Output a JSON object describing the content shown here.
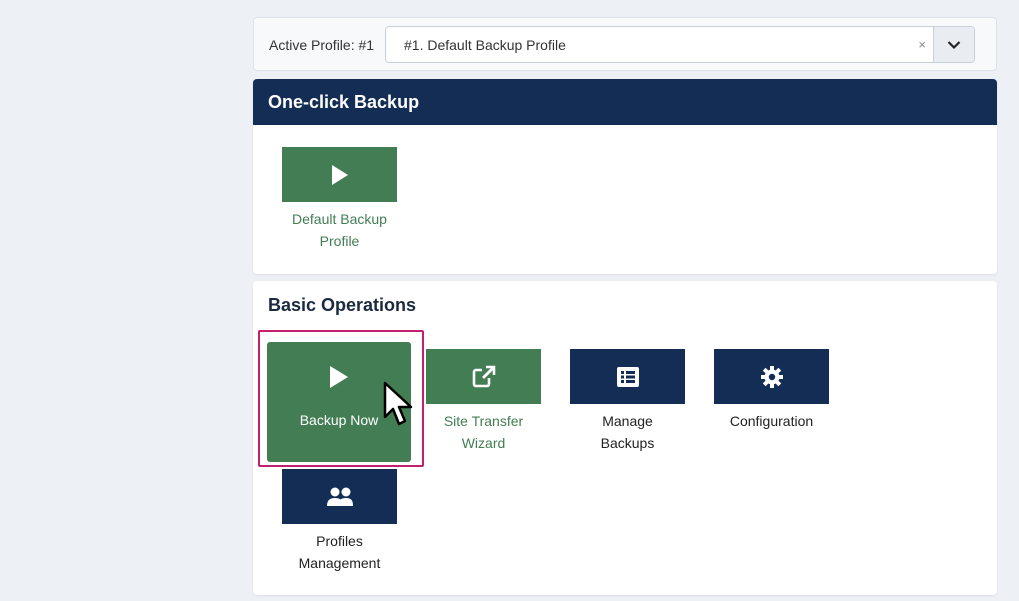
{
  "profile": {
    "label": "Active Profile: #1",
    "selected": "#1. Default Backup Profile",
    "clear_glyph": "×"
  },
  "one_click": {
    "title": "One-click Backup",
    "tiles": [
      {
        "label": "Default Backup Profile",
        "icon": "play-icon",
        "color": "#437d54"
      }
    ]
  },
  "basic": {
    "title": "Basic Operations",
    "tiles": [
      {
        "label": "Backup Now",
        "icon": "play-icon",
        "color": "#437d54",
        "state": "hovered"
      },
      {
        "label": "Site Transfer Wizard",
        "icon": "external-link-icon",
        "color": "#437d54"
      },
      {
        "label": "Manage Backups",
        "icon": "list-icon",
        "color": "#132d54"
      },
      {
        "label": "Configuration",
        "icon": "gear-icon",
        "color": "#132d54"
      },
      {
        "label": "Profiles Management",
        "icon": "users-icon",
        "color": "#132d54"
      }
    ]
  },
  "colors": {
    "header_navy": "#132d54",
    "action_green": "#437d54",
    "highlight_border": "#c2206f",
    "page_bg": "#edf1f6"
  }
}
